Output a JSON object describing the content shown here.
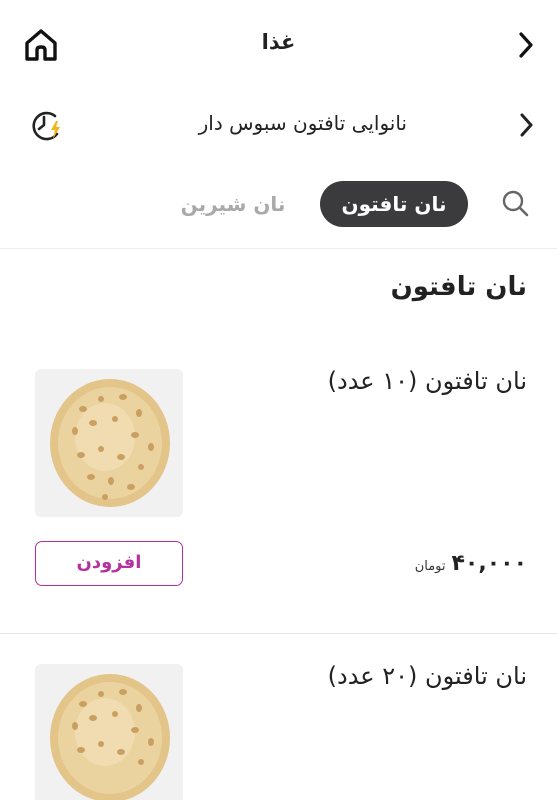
{
  "header": {
    "title": "غذا",
    "home_icon": "home-icon",
    "back_icon": "chevron-right-icon"
  },
  "shop": {
    "name": "نانوایی تافتون سبوس دار",
    "status_icon": "clock-bolt-icon"
  },
  "tabs": {
    "search_icon": "search-icon",
    "items": [
      {
        "label": "نان تافتون",
        "active": true
      },
      {
        "label": "نان شیرین",
        "active": false
      }
    ]
  },
  "section": {
    "title": "نان تافتون"
  },
  "products": [
    {
      "name": "نان تافتون (۱۰ عدد)",
      "price": "۴۰,۰۰۰",
      "currency": "تومان",
      "add_label": "افزودن"
    },
    {
      "name": "نان تافتون (۲۰ عدد)"
    }
  ],
  "colors": {
    "accent": "#b3329d",
    "tab_active_bg": "#3b3b3d",
    "tab_inactive_text": "#a9a9a9",
    "status_bolt": "#f2b51a"
  }
}
